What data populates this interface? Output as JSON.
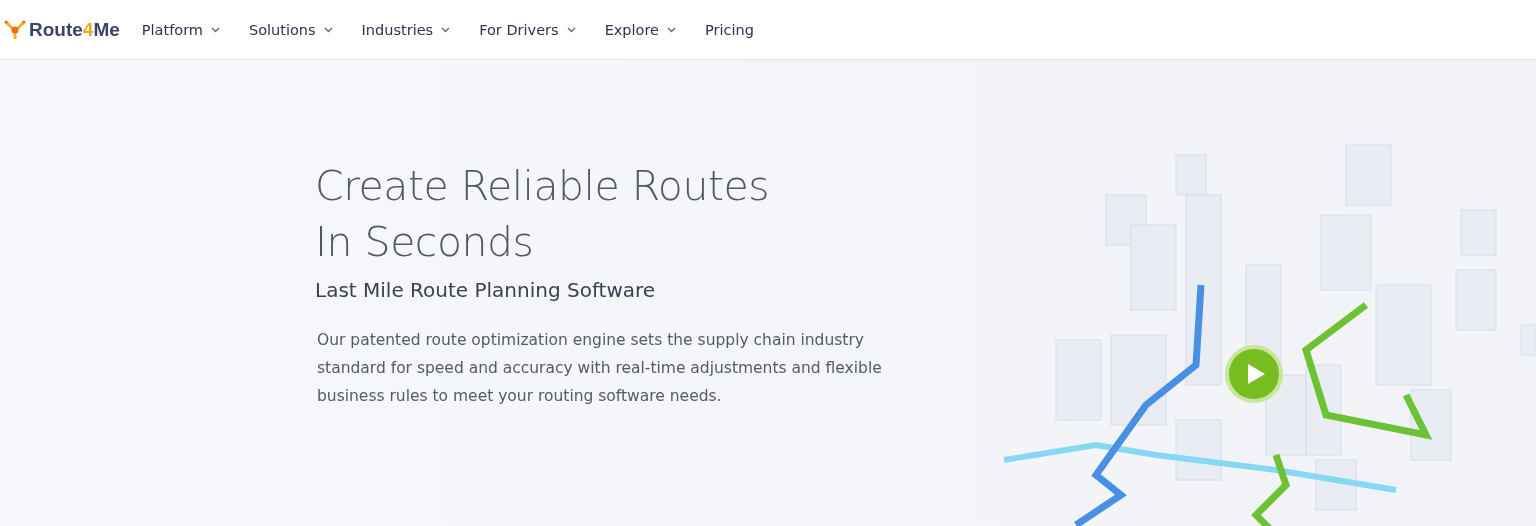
{
  "header": {
    "logo": {
      "parts": [
        {
          "text": "Route",
          "accent": false
        },
        {
          "text": "4",
          "accent": true
        },
        {
          "text": "Me",
          "accent": false
        }
      ]
    },
    "nav": [
      {
        "label": "Platform",
        "has_dropdown": true
      },
      {
        "label": "Solutions",
        "has_dropdown": true
      },
      {
        "label": "Industries",
        "has_dropdown": true
      },
      {
        "label": "For Drivers",
        "has_dropdown": true
      },
      {
        "label": "Explore",
        "has_dropdown": true
      },
      {
        "label": "Pricing",
        "has_dropdown": false
      }
    ]
  },
  "hero": {
    "title_lines": [
      "Create Reliable Routes",
      "In Seconds"
    ],
    "subtitle": "Last Mile Route Planning Software",
    "description": "Our patented route optimization engine sets the supply chain industry standard for speed and accuracy with real-time adjustments and flexible business rules to meet your routing software needs."
  }
}
